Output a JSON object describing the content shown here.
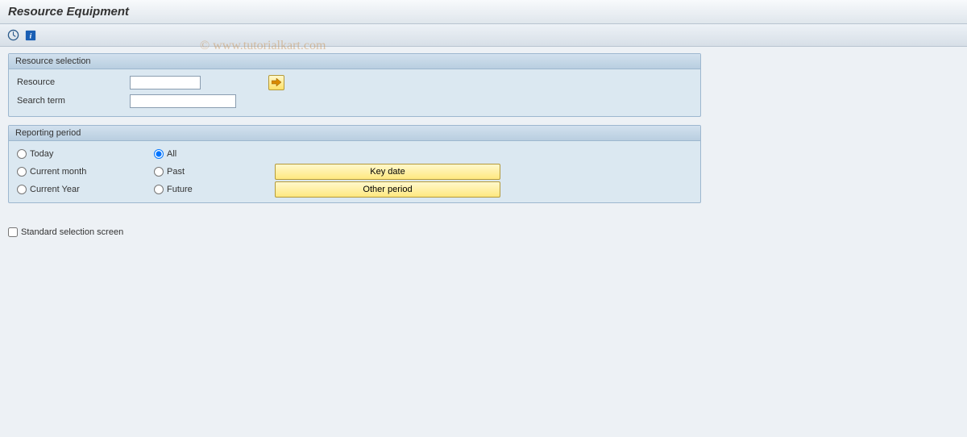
{
  "title": "Resource Equipment",
  "watermark": "© www.tutorialkart.com",
  "toolbar": {
    "execute_icon": "execute-icon",
    "info_icon": "info-icon"
  },
  "groups": {
    "resource_selection": {
      "title": "Resource selection",
      "resource_label": "Resource",
      "resource_value": "",
      "search_term_label": "Search term",
      "search_term_value": ""
    },
    "reporting_period": {
      "title": "Reporting period",
      "options": {
        "today": "Today",
        "current_month": "Current month",
        "current_year": "Current Year",
        "all": "All",
        "past": "Past",
        "future": "Future"
      },
      "selected": "all",
      "buttons": {
        "key_date": "Key date",
        "other_period": "Other period"
      }
    }
  },
  "checkbox": {
    "standard_selection": "Standard selection screen",
    "checked": false
  }
}
